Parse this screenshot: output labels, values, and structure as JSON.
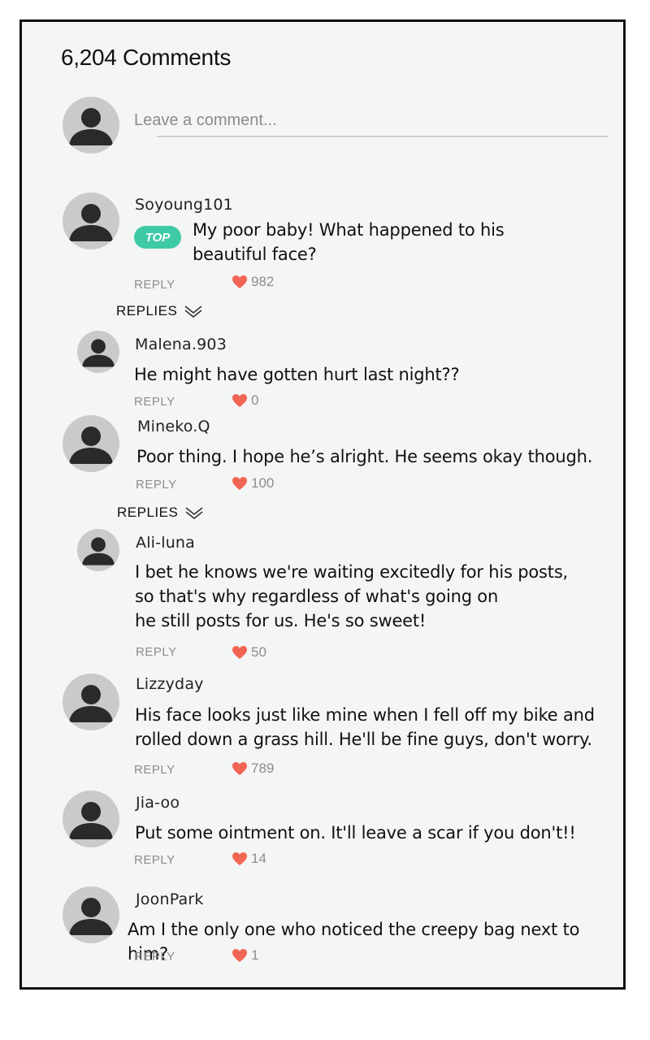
{
  "header": {
    "comment_count": "6,204 Comments"
  },
  "composer": {
    "placeholder": "Leave a comment..."
  },
  "labels": {
    "reply": "REPLY",
    "replies": "REPLIES",
    "top": "TOP"
  },
  "colors": {
    "heart": "#f26552",
    "top_badge": "#3fcaa6",
    "avatar_bg": "#c9caca",
    "avatar_fg": "#2a2a2a"
  },
  "icons": {
    "avatar": "user-silhouette-icon",
    "like": "heart-icon",
    "expand": "double-chevron-down-icon"
  },
  "comments": [
    {
      "user": "Soyoung101",
      "lines": [
        "My poor baby! What happened to his",
        "beautiful face?"
      ],
      "likes": "982",
      "top": true
    },
    {
      "user": "Malena.903",
      "lines": [
        "He might have gotten hurt last night??"
      ],
      "likes": "0"
    },
    {
      "user": "Mineko.Q",
      "lines": [
        "Poor thing. I hope he’s alright. He seems okay though."
      ],
      "likes": "100"
    },
    {
      "user": "Ali-luna",
      "lines": [
        "I bet he knows we're waiting excitedly for his posts,",
        "so that's why regardless of what's going on",
        "he still posts for us. He's so sweet!"
      ],
      "likes": "50"
    },
    {
      "user": "Lizzyday",
      "lines": [
        "His face looks just like mine when I fell off my bike and",
        "rolled down a grass hill. He'll be fine guys, don't worry."
      ],
      "likes": "789"
    },
    {
      "user": "Jia-oo",
      "lines": [
        "Put some ointment on. It'll leave a scar if you don't!!"
      ],
      "likes": "14"
    },
    {
      "user": "JoonPark",
      "lines": [
        "Am I the only one who noticed the creepy bag next to him?"
      ],
      "likes": "1"
    }
  ]
}
